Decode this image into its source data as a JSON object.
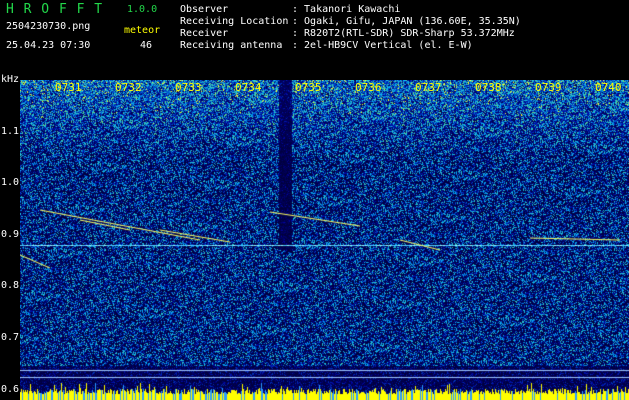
{
  "header": {
    "app_name": "H R O F F T",
    "version": "1.0.0",
    "filename": "2504230730.png",
    "datetime": "25.04.23 07:30",
    "meteor_label": "meteor",
    "meteor_count": "46",
    "info": [
      {
        "key": "Observer",
        "value": ": Takanori Kawachi"
      },
      {
        "key": "Receiving Location",
        "value": ": Ogaki, Gifu, JAPAN (136.60E, 35.35N)"
      },
      {
        "key": "Receiver",
        "value": ": R820T2(RTL-SDR) SDR-Sharp 53.372MHz"
      },
      {
        "key": "Receiving antenna",
        "value": ": 2el-HB9CV Vertical (el. E-W)"
      }
    ]
  },
  "chart_data": {
    "type": "heatmap",
    "ylabel": "kHz",
    "y_ticks": [
      "1.1",
      "1.0",
      "0.9",
      "0.8",
      "0.7",
      "0.6"
    ],
    "x_ticks": [
      "0731",
      "0732",
      "0733",
      "0734",
      "0735",
      "0736",
      "0737",
      "0738",
      "0739",
      "0740"
    ],
    "carrier_khz": 0.88
  },
  "colors": {
    "title_green": "#22d84a",
    "tick_yellow": "#ffff00",
    "background": "#000000"
  }
}
